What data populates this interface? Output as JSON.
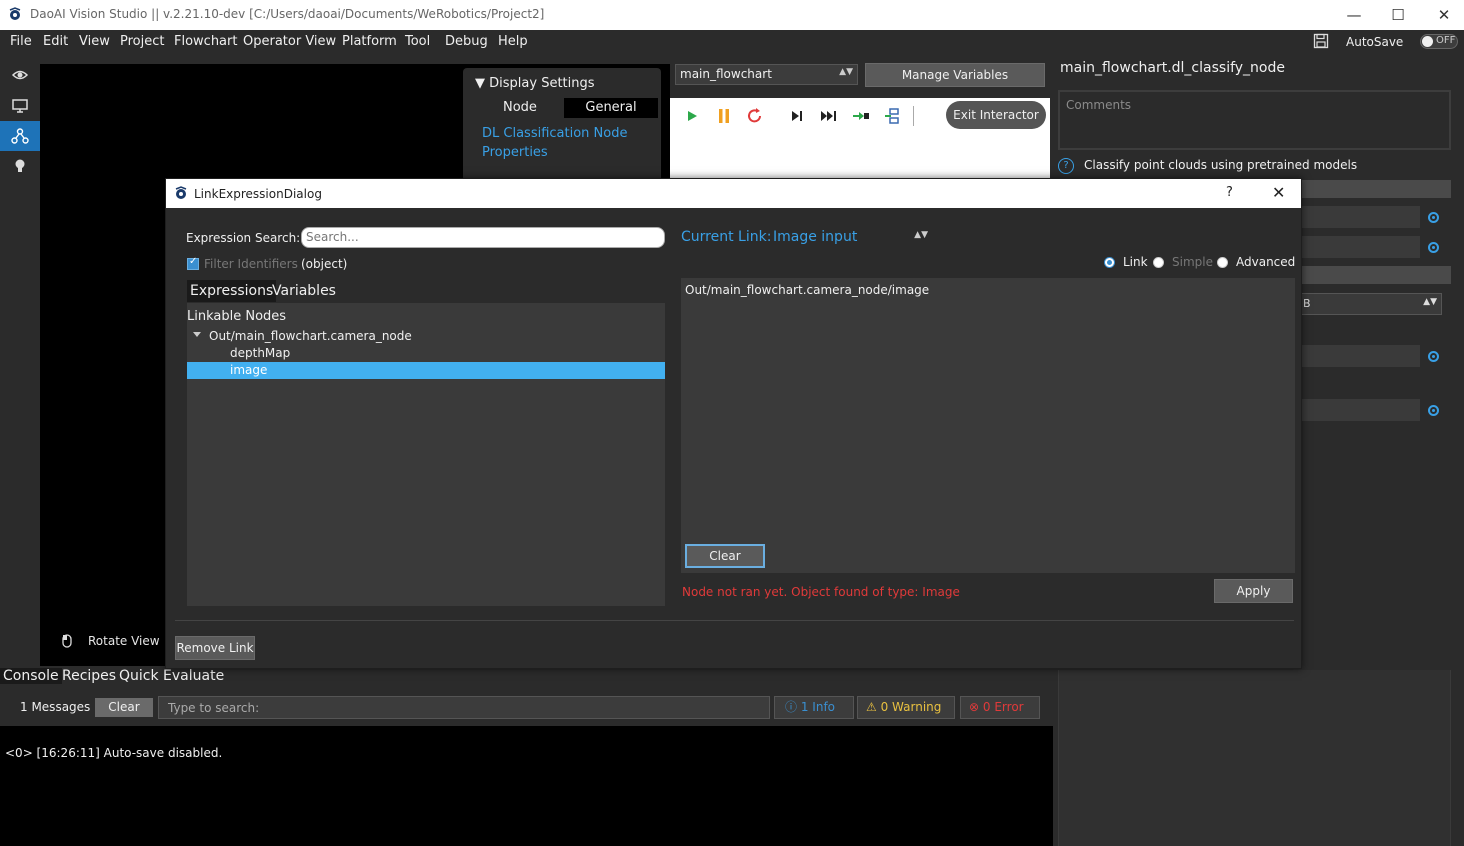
{
  "window": {
    "title": "DaoAI Vision Studio || v.2.21.10-dev   [C:/Users/daoai/Documents/WeRobotics/Project2]",
    "minimize": "—",
    "maximize": "☐",
    "close": "✕"
  },
  "menu": {
    "items": [
      "File",
      "Edit",
      "View",
      "Project",
      "Flowchart",
      "Operator View",
      "Platform",
      "Tool",
      "Debug",
      "Help"
    ],
    "autosave_label": "AutoSave",
    "autosave_state": "OFF"
  },
  "viewport": {
    "hint": "Rotate View"
  },
  "display_settings": {
    "header": "Display Settings",
    "tab_node": "Node",
    "tab_general": "General",
    "link_text": "DL Classification Node Properties"
  },
  "flowchart": {
    "selected": "main_flowchart",
    "manage_variables": "Manage Variables",
    "exit_interactor": "Exit Interactor"
  },
  "properties": {
    "node_name": "main_flowchart.dl_classify_node",
    "comments_placeholder": "Comments",
    "description": "Classify point clouds using pretrained models",
    "combo_value": "B"
  },
  "console": {
    "tabs": [
      "Console",
      "Recipes",
      "Quick Evaluate"
    ],
    "messages": "1 Messages",
    "clear": "Clear",
    "search_placeholder": "Type to search:",
    "info": "1 Info",
    "warning": "0 Warning",
    "error": "0 Error",
    "log_line": "<0> [16:26:11] Auto-save disabled."
  },
  "dialog": {
    "title": "LinkExpressionDialog",
    "help": "?",
    "close": "✕",
    "search_label": "Expression Search:",
    "search_placeholder": "Search...",
    "filter_label": "Filter Identifiers",
    "object_type": "(object)",
    "tabs": [
      "Expressions",
      "Variables In"
    ],
    "tree_header": "Linkable Nodes",
    "tree_node": "Out/main_flowchart.camera_node",
    "tree_children": [
      "depthMap",
      "image"
    ],
    "current_link_label": "Current Link:",
    "current_link_value": "Image input",
    "mode_link": "Link",
    "mode_simple": "Simple",
    "mode_advanced": "Advanced",
    "expression": "Out/main_flowchart.camera_node/image",
    "clear": "Clear",
    "status": "Node not ran yet. Object found of type: Image",
    "apply": "Apply",
    "remove_link": "Remove Link"
  },
  "colors": {
    "accent": "#39a0e6",
    "selection": "#42b0f0",
    "error": "#e03a3a",
    "warning": "#e8c040"
  }
}
